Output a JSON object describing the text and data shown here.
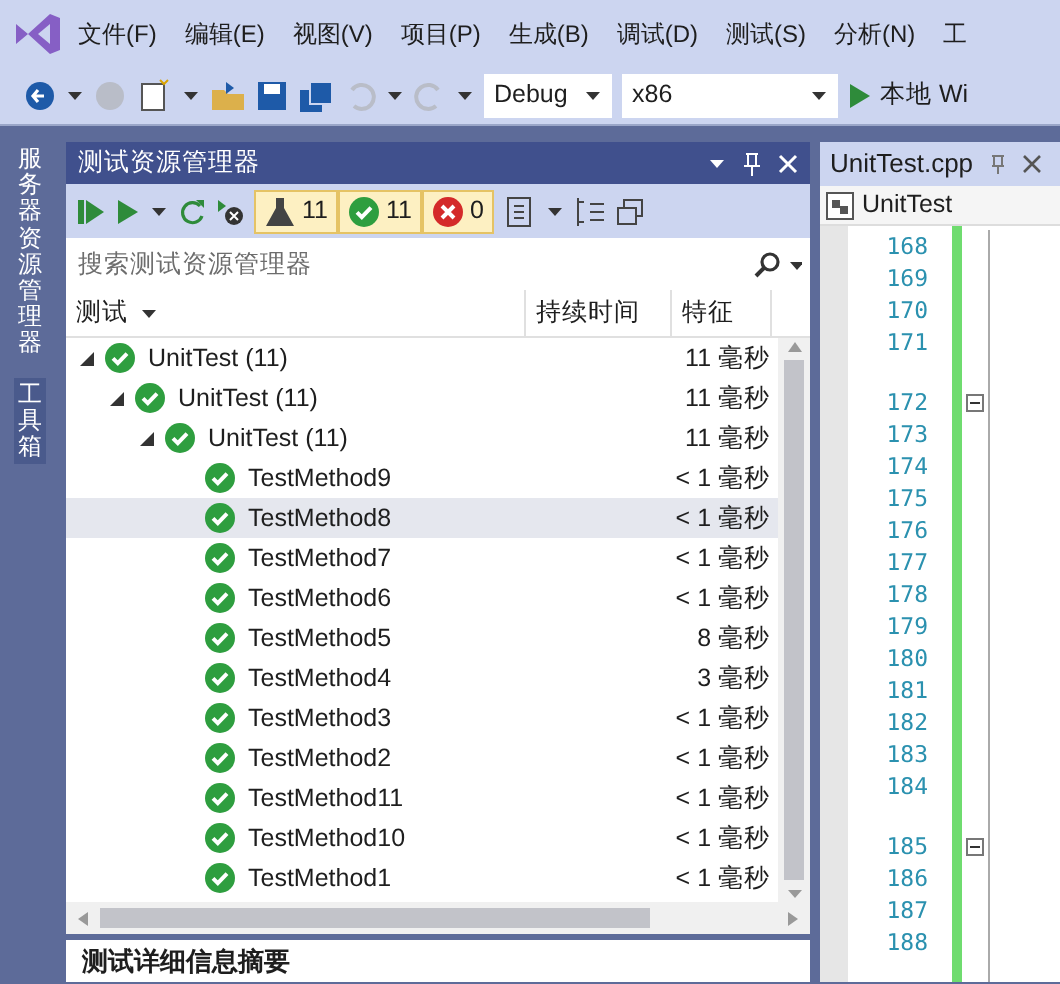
{
  "menu": [
    {
      "label": "文件(F)"
    },
    {
      "label": "编辑(E)"
    },
    {
      "label": "视图(V)"
    },
    {
      "label": "项目(P)"
    },
    {
      "label": "生成(B)"
    },
    {
      "label": "调试(D)"
    },
    {
      "label": "测试(S)"
    },
    {
      "label": "分析(N)"
    },
    {
      "label": "工"
    }
  ],
  "toolbar": {
    "configuration": "Debug",
    "platform": "x86",
    "run_label": "本地 Wi"
  },
  "side_tabs": [
    {
      "label": "服务器资源管理器"
    },
    {
      "label": "工具箱"
    }
  ],
  "test_explorer": {
    "title": "测试资源管理器",
    "counts": [
      {
        "kind": "total",
        "value": "11"
      },
      {
        "kind": "passed",
        "value": "11"
      },
      {
        "kind": "failed",
        "value": "0"
      }
    ],
    "search": {
      "placeholder": "搜索测试资源管理器"
    },
    "columns": [
      "测试",
      "持续时间",
      "特征"
    ],
    "tree": [
      {
        "name": "UnitTest (11)",
        "duration": "11 毫秒",
        "expanded": true,
        "selected": false,
        "children": [
          {
            "name": "UnitTest (11)",
            "duration": "11 毫秒",
            "expanded": true,
            "selected": false,
            "children": [
              {
                "name": "UnitTest (11)",
                "duration": "11 毫秒",
                "expanded": true,
                "selected": false,
                "children": [
                  {
                    "name": "TestMethod9",
                    "duration": "< 1 毫秒",
                    "selected": false
                  },
                  {
                    "name": "TestMethod8",
                    "duration": "< 1 毫秒",
                    "selected": true
                  },
                  {
                    "name": "TestMethod7",
                    "duration": "< 1 毫秒",
                    "selected": false
                  },
                  {
                    "name": "TestMethod6",
                    "duration": "< 1 毫秒",
                    "selected": false
                  },
                  {
                    "name": "TestMethod5",
                    "duration": "8 毫秒",
                    "selected": false
                  },
                  {
                    "name": "TestMethod4",
                    "duration": "3 毫秒",
                    "selected": false
                  },
                  {
                    "name": "TestMethod3",
                    "duration": "< 1 毫秒",
                    "selected": false
                  },
                  {
                    "name": "TestMethod2",
                    "duration": "< 1 毫秒",
                    "selected": false
                  },
                  {
                    "name": "TestMethod11",
                    "duration": "< 1 毫秒",
                    "selected": false
                  },
                  {
                    "name": "TestMethod10",
                    "duration": "< 1 毫秒",
                    "selected": false
                  },
                  {
                    "name": "TestMethod1",
                    "duration": "< 1 毫秒",
                    "selected": false
                  }
                ]
              }
            ]
          }
        ]
      }
    ],
    "summary": "测试详细信息摘要"
  },
  "editor": {
    "tab": "UnitTest.cpp",
    "navigation": "UnitTest",
    "lines": [
      {
        "kind": "number",
        "number": "168",
        "fold": false
      },
      {
        "kind": "number",
        "number": "169",
        "fold": false
      },
      {
        "kind": "number",
        "number": "170",
        "fold": false
      },
      {
        "kind": "number",
        "number": "171",
        "fold": false
      },
      {
        "kind": "gap"
      },
      {
        "kind": "number",
        "number": "172",
        "fold": true
      },
      {
        "kind": "number",
        "number": "173",
        "fold": false
      },
      {
        "kind": "number",
        "number": "174",
        "fold": false
      },
      {
        "kind": "number",
        "number": "175",
        "fold": false
      },
      {
        "kind": "number",
        "number": "176",
        "fold": false
      },
      {
        "kind": "number",
        "number": "177",
        "fold": false
      },
      {
        "kind": "number",
        "number": "178",
        "fold": false
      },
      {
        "kind": "number",
        "number": "179",
        "fold": false
      },
      {
        "kind": "number",
        "number": "180",
        "fold": false
      },
      {
        "kind": "number",
        "number": "181",
        "fold": false
      },
      {
        "kind": "number",
        "number": "182",
        "fold": false
      },
      {
        "kind": "number",
        "number": "183",
        "fold": false
      },
      {
        "kind": "number",
        "number": "184",
        "fold": false
      },
      {
        "kind": "gap"
      },
      {
        "kind": "number",
        "number": "185",
        "fold": true
      },
      {
        "kind": "number",
        "number": "186",
        "fold": false
      },
      {
        "kind": "number",
        "number": "187",
        "fold": false
      },
      {
        "kind": "number",
        "number": "188",
        "fold": false
      }
    ]
  }
}
